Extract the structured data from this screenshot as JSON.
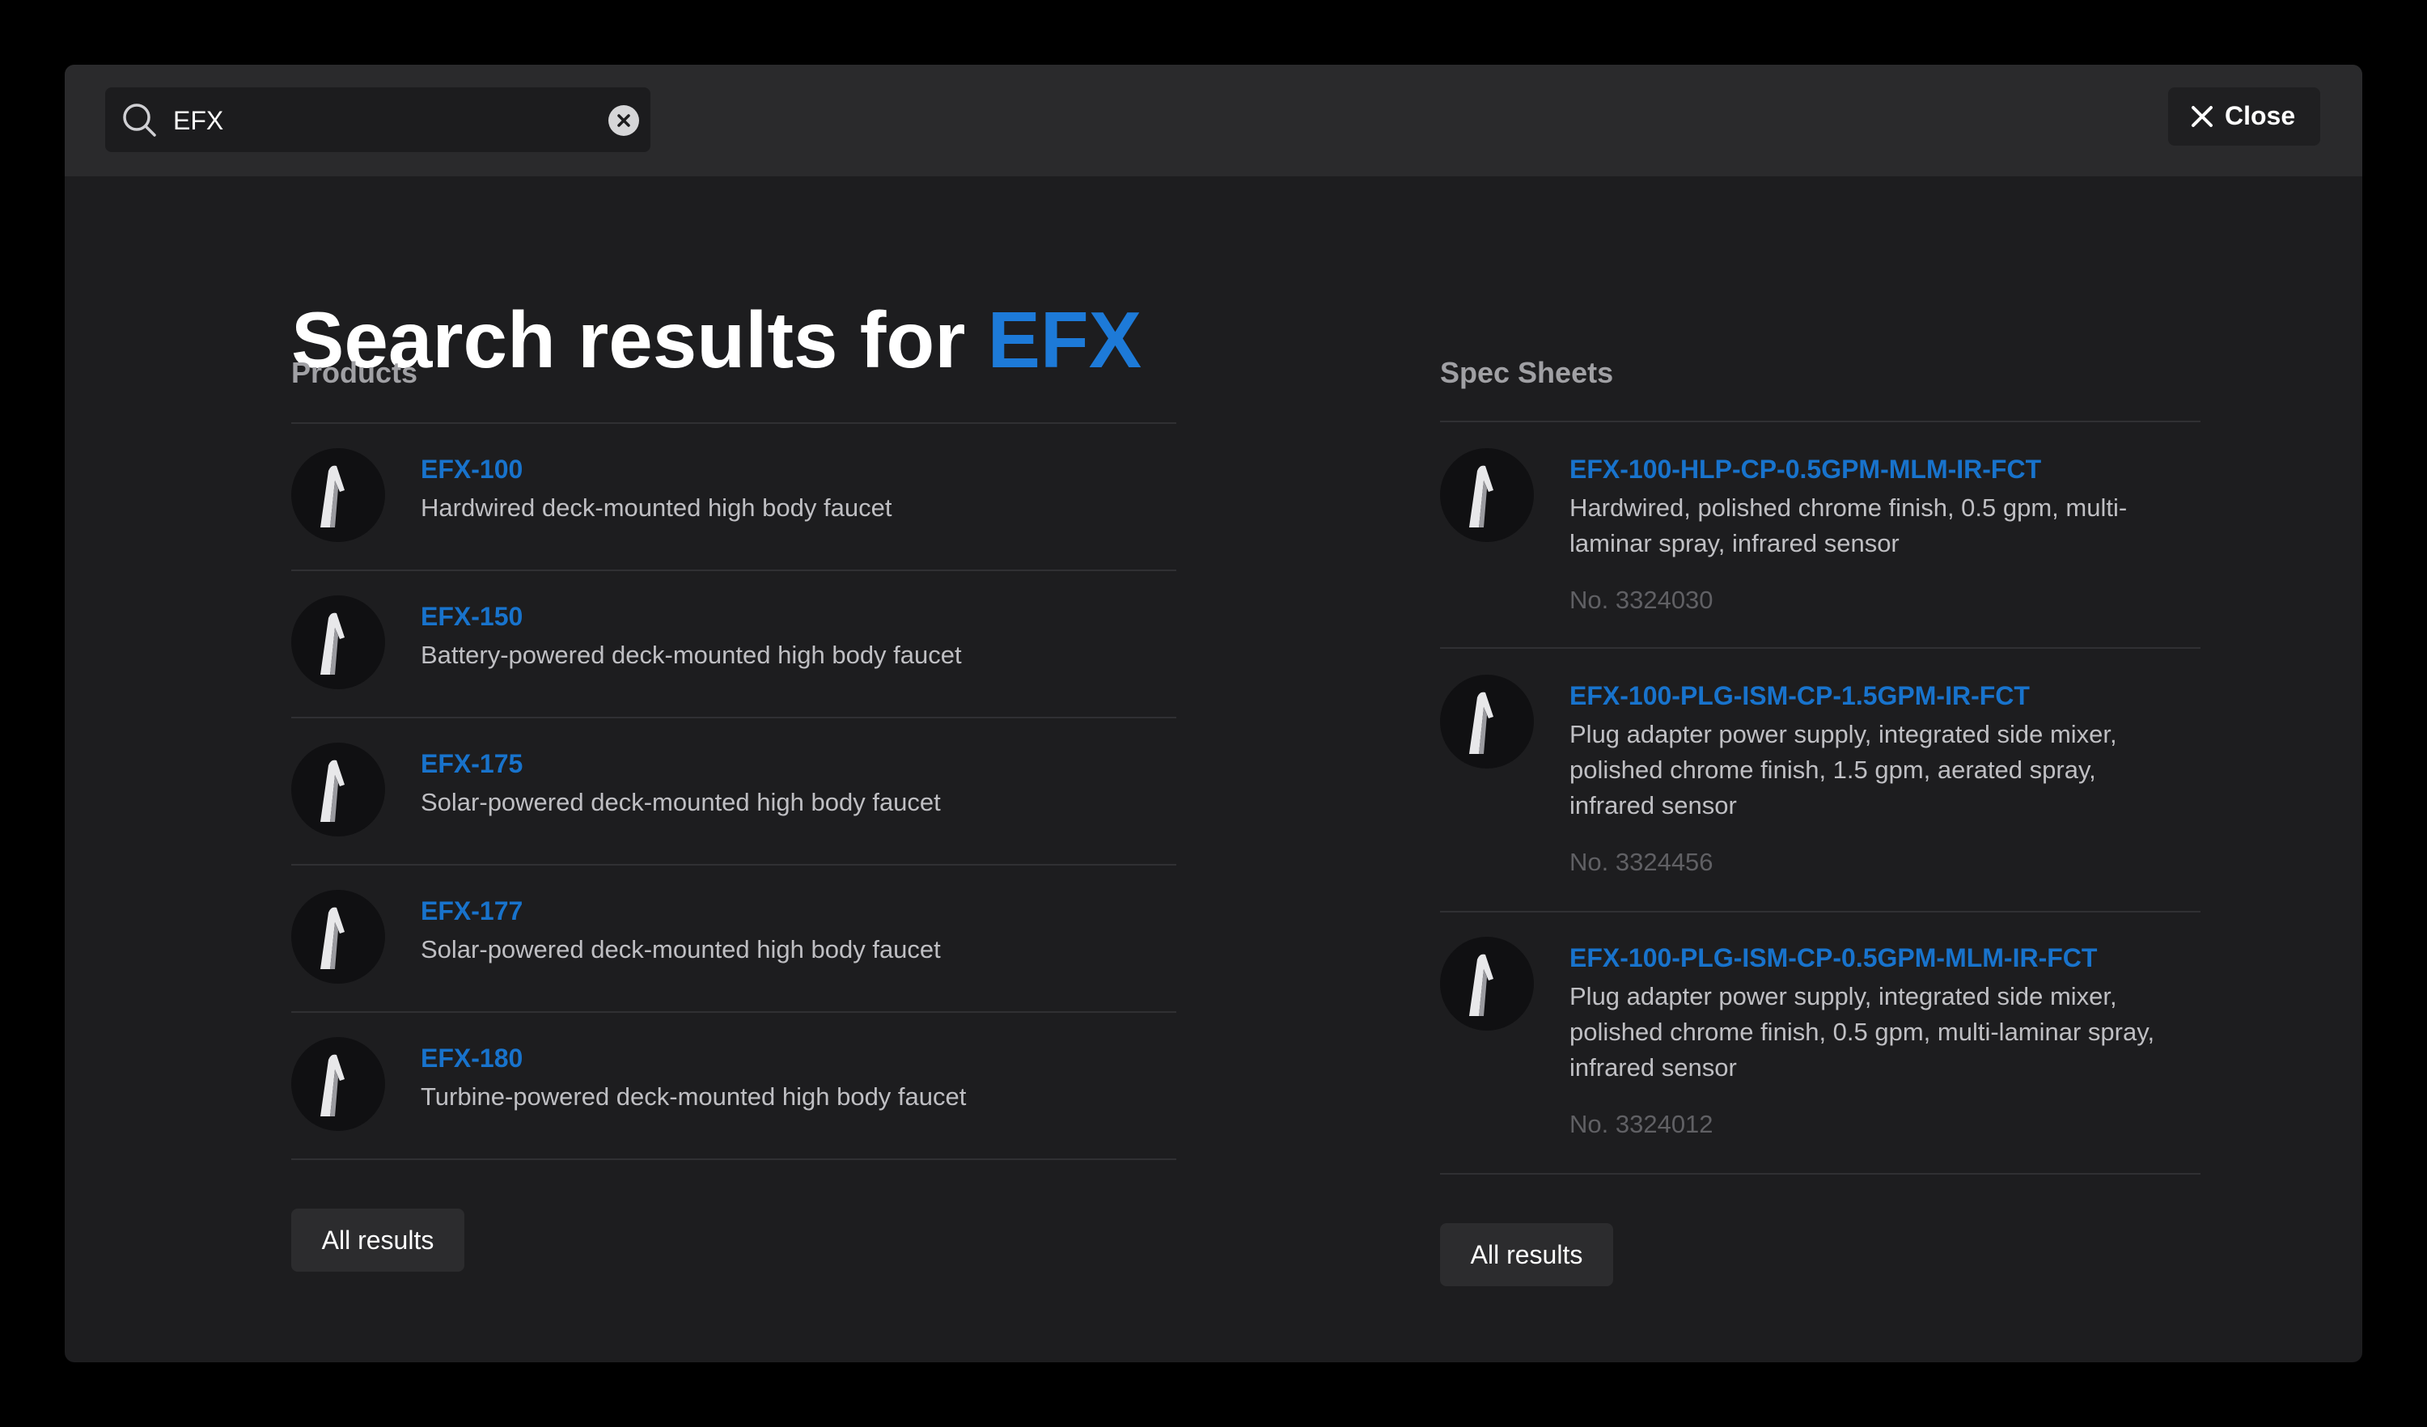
{
  "search": {
    "value": "EFX",
    "placeholder": ""
  },
  "close_label": "Close",
  "heading": {
    "prefix": "Search results for ",
    "term": "EFX"
  },
  "products": {
    "title": "Products",
    "items": [
      {
        "title": "EFX-100",
        "desc": "Hardwired deck-mounted high body faucet"
      },
      {
        "title": "EFX-150",
        "desc": "Battery-powered deck-mounted high body faucet"
      },
      {
        "title": "EFX-175",
        "desc": "Solar-powered deck-mounted high body faucet"
      },
      {
        "title": "EFX-177",
        "desc": "Solar-powered deck-mounted high body faucet"
      },
      {
        "title": "EFX-180",
        "desc": "Turbine-powered deck-mounted high body faucet"
      }
    ],
    "all_results_label": "All results"
  },
  "spec_sheets": {
    "title": "Spec Sheets",
    "items": [
      {
        "title": "EFX-100-HLP-CP-0.5GPM-MLM-IR-FCT",
        "desc": "Hardwired, polished chrome finish, 0.5 gpm, multi-laminar spray, infrared sensor",
        "number": "No. 3324030"
      },
      {
        "title": "EFX-100-PLG-ISM-CP-1.5GPM-IR-FCT",
        "desc": "Plug adapter power supply, integrated side mixer, polished chrome finish, 1.5 gpm, aerated spray, infrared sensor",
        "number": "No. 3324456"
      },
      {
        "title": "EFX-100-PLG-ISM-CP-0.5GPM-MLM-IR-FCT",
        "desc": "Plug adapter power supply, integrated side mixer, polished chrome finish, 0.5 gpm, multi-laminar spray, infrared sensor",
        "number": "No. 3324012"
      }
    ],
    "all_results_label": "All results"
  },
  "colors": {
    "accent": "#1d7ad8",
    "link": "#1873cc",
    "background": "#1d1d1f",
    "topbar": "#2a2a2c"
  }
}
